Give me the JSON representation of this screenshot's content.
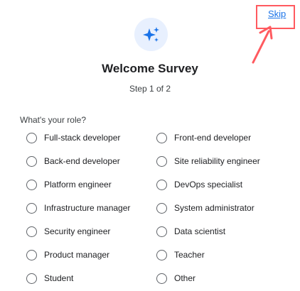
{
  "header": {
    "skip_label": "Skip",
    "icon": "sparkles-icon"
  },
  "survey": {
    "title": "Welcome Survey",
    "step": "Step 1 of 2",
    "question": "What's your role?"
  },
  "options": [
    "Full-stack developer",
    "Front-end developer",
    "Back-end developer",
    "Site reliability engineer",
    "Platform engineer",
    "DevOps specialist",
    "Infrastructure manager",
    "System administrator",
    "Security engineer",
    "Data scientist",
    "Product manager",
    "Teacher",
    "Student",
    "Other"
  ],
  "colors": {
    "accent": "#1a73e8",
    "annotation": "#ff5a5f",
    "icon_bg": "#e8f0fe"
  }
}
